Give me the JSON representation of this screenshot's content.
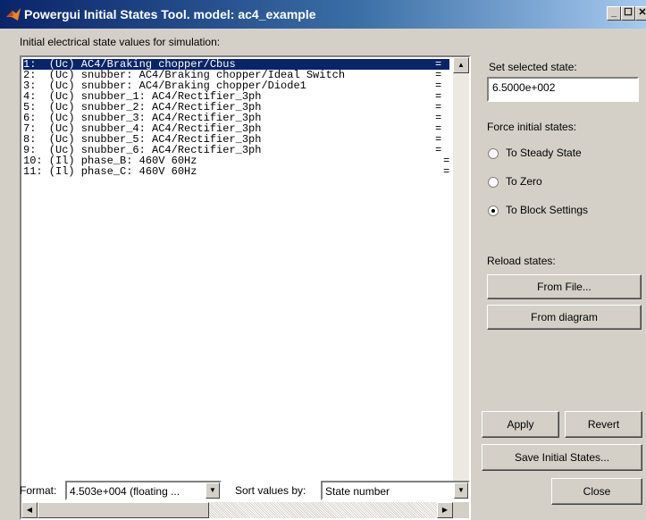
{
  "window": {
    "title": "Powergui Initial States Tool. model: ac4_example",
    "minimize": "_",
    "maximize": "☐",
    "close": "✕"
  },
  "list_label": "Initial electrical state values for simulation:",
  "states": [
    {
      "text": "1:  (Uc) AC4/Braking chopper/Cbus",
      "eq": "="
    },
    {
      "text": "2:  (Uc) snubber: AC4/Braking chopper/Ideal Switch",
      "eq": "="
    },
    {
      "text": "3:  (Uc) snubber: AC4/Braking chopper/Diode1",
      "eq": "="
    },
    {
      "text": "4:  (Uc) snubber_1: AC4/Rectifier_3ph",
      "eq": "="
    },
    {
      "text": "5:  (Uc) snubber_2: AC4/Rectifier_3ph",
      "eq": "="
    },
    {
      "text": "6:  (Uc) snubber_3: AC4/Rectifier_3ph",
      "eq": "="
    },
    {
      "text": "7:  (Uc) snubber_4: AC4/Rectifier_3ph",
      "eq": "="
    },
    {
      "text": "8:  (Uc) snubber_5: AC4/Rectifier_3ph",
      "eq": "="
    },
    {
      "text": "9:  (Uc) snubber_6: AC4/Rectifier_3ph",
      "eq": "="
    },
    {
      "text": "10: (Il) phase_B: 460V 60Hz",
      "eq": "="
    },
    {
      "text": "11: (Il) phase_C: 460V 60Hz",
      "eq": "="
    }
  ],
  "set_state": {
    "label": "Set selected state:",
    "value": "6.5000e+002"
  },
  "force": {
    "label": "Force initial states:",
    "options": [
      "To Steady State",
      "To Zero",
      "To Block Settings"
    ],
    "selected": "To Block Settings"
  },
  "reload": {
    "label": "Reload states:",
    "from_file": "From File...",
    "from_diagram": "From diagram"
  },
  "buttons": {
    "apply": "Apply",
    "revert": "Revert",
    "save": "Save Initial States...",
    "close": "Close"
  },
  "format": {
    "label": "Format:",
    "value": "4.503e+004 (floating ..."
  },
  "sort": {
    "label": "Sort values by:",
    "value": "State number"
  },
  "colors": {
    "selection": "#0a246a",
    "titlebar_start": "#0a246a",
    "dialog_bg": "#d4d0c8"
  }
}
